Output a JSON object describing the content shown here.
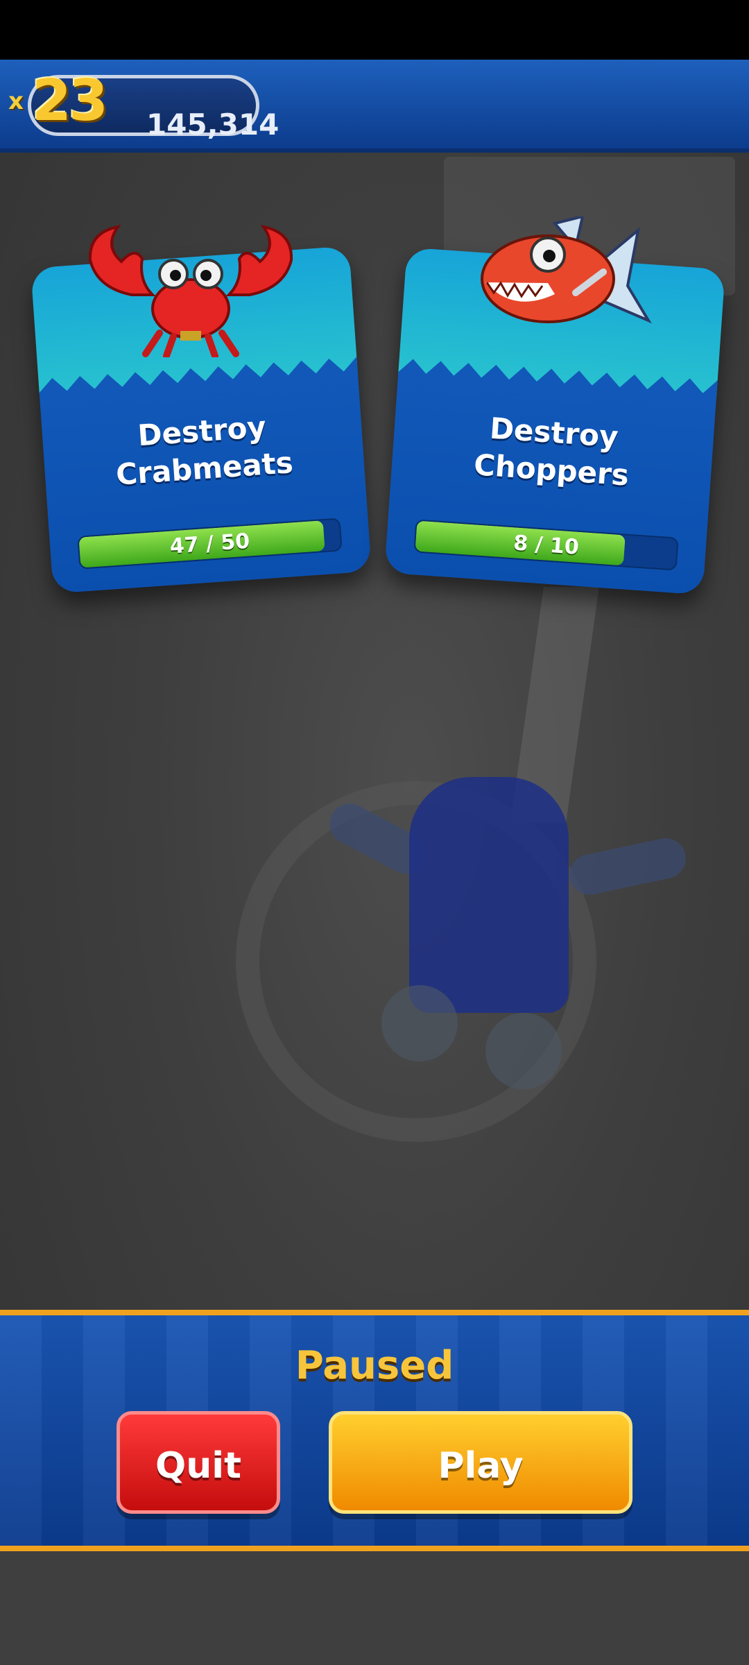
{
  "hud": {
    "multiplier_prefix": "x",
    "multiplier": "23",
    "score": "145,314"
  },
  "missions": [
    {
      "title": "Destroy\nCrabmeats",
      "progress_text": "47 / 50",
      "progress_fraction": 0.94,
      "icon": "crabmeat-icon"
    },
    {
      "title": "Destroy\nChoppers",
      "progress_text": "8 / 10",
      "progress_fraction": 0.8,
      "icon": "chopper-fish-icon"
    }
  ],
  "pause_menu": {
    "title": "Paused",
    "quit_label": "Quit",
    "play_label": "Play"
  },
  "colors": {
    "hud_blue": "#1e60bd",
    "accent_gold": "#f0a21e",
    "quit_red": "#d31414",
    "play_orange": "#f5a515",
    "progress_green": "#5cc22c"
  }
}
